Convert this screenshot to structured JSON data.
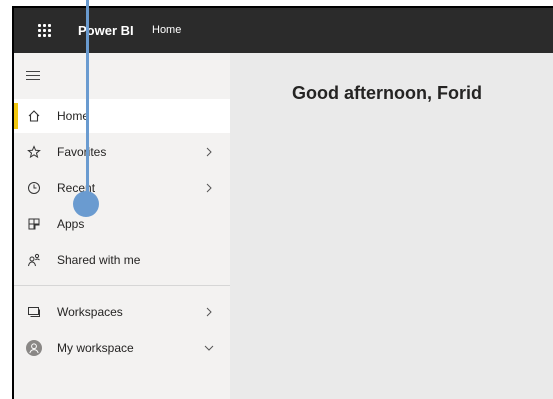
{
  "topbar": {
    "app_name": "Power BI",
    "breadcrumb": "Home",
    "icon": "waffle-icon"
  },
  "sidebar": {
    "items": [
      {
        "label": "Home",
        "icon": "home-icon",
        "active": true
      },
      {
        "label": "Favorites",
        "icon": "star-icon",
        "chevron": "right"
      },
      {
        "label": "Recent",
        "icon": "clock-icon",
        "chevron": "right"
      },
      {
        "label": "Apps",
        "icon": "apps-icon"
      },
      {
        "label": "Shared with me",
        "icon": "shared-people-icon"
      },
      {
        "label": "Workspaces",
        "icon": "workspaces-icon",
        "chevron": "right"
      },
      {
        "label": "My workspace",
        "icon": "avatar-icon",
        "chevron": "down"
      }
    ]
  },
  "main": {
    "greeting": "Good afternoon, Forid"
  },
  "colors": {
    "topbar": "#2b2b2b",
    "sidebar": "#f3f2f1",
    "main": "#eaeaea",
    "active_indicator": "#f2c811",
    "pointer": "#6a9bd0"
  }
}
